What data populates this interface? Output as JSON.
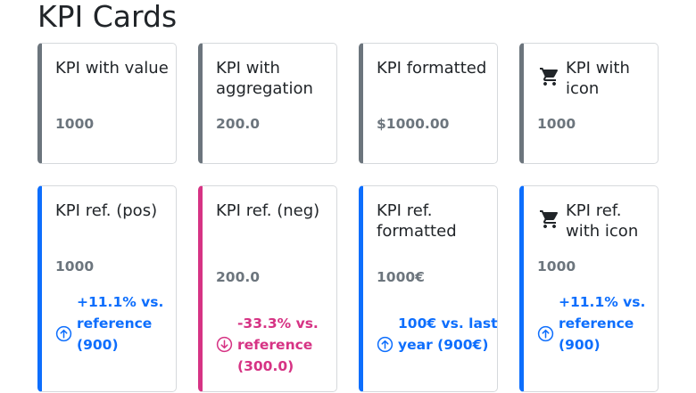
{
  "page": {
    "title": "KPI Cards"
  },
  "row1": [
    {
      "title": "KPI with value",
      "value": "1000",
      "icon": null
    },
    {
      "title": "KPI with aggregation",
      "value": "200.0",
      "icon": null
    },
    {
      "title": "KPI formatted",
      "value": "$1000.00",
      "icon": null
    },
    {
      "title": "KPI with icon",
      "value": "1000",
      "icon": "shopping-cart-icon"
    }
  ],
  "row2": [
    {
      "title": "KPI ref. (pos)",
      "value": "1000",
      "reference": "+11.1% vs. reference (900)",
      "direction": "up",
      "icon": null
    },
    {
      "title": "KPI ref. (neg)",
      "value": "200.0",
      "reference": "-33.3% vs. reference (300.0)",
      "direction": "down",
      "icon": null
    },
    {
      "title": "KPI ref. formatted",
      "value": "1000€",
      "reference": "100€ vs. last year (900€)",
      "direction": "up",
      "icon": null
    },
    {
      "title": "KPI ref. with icon",
      "value": "1000",
      "reference": "+11.1% vs. reference (900)",
      "direction": "up",
      "icon": "shopping-cart-icon"
    }
  ],
  "colors": {
    "neutral": "#6c757d",
    "positive": "#0d6efd",
    "negative": "#d63384",
    "border": "#d6d9dc"
  }
}
